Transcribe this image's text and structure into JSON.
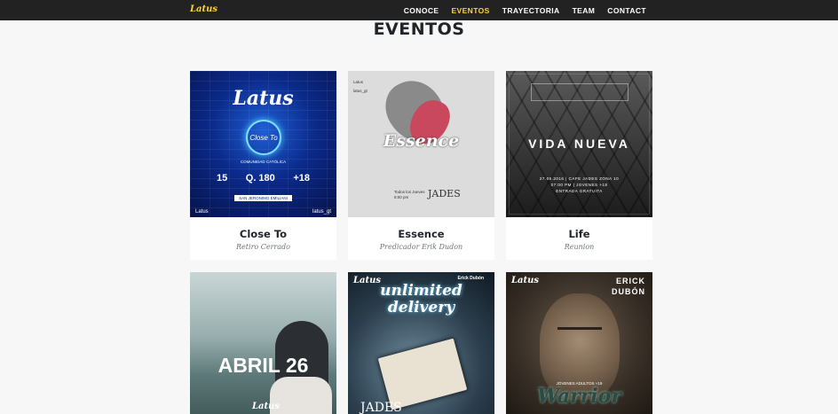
{
  "nav": {
    "brand": "Latus",
    "links": [
      "CONOCE",
      "EVENTOS",
      "TRAYECTORIA",
      "TEAM",
      "CONTACT"
    ],
    "active": "EVENTOS"
  },
  "section": {
    "title": "EVENTOS"
  },
  "colors": {
    "navbar": "#222222",
    "accent": "#fed136",
    "page": "#f7f7f7"
  },
  "events": [
    {
      "title": "Close To",
      "subtitle": "Retiro Cerrado",
      "poster": {
        "logo": "Latus",
        "badge": "Close To",
        "community": "COMUNIDAD CATÓLICA",
        "date_day": "15",
        "price": "Q. 180",
        "age": "+18",
        "place": "SAN JERONIMO EMILIANI",
        "footer_left": "Latus",
        "footer_right": "latus_gt"
      }
    },
    {
      "title": "Essence",
      "subtitle": "Predicador Erik Dudon",
      "poster": {
        "social_fb": "Latus",
        "social_ig": "latus_gt",
        "brand": "Essence",
        "when": "Todos los Jueves",
        "time": "8:00 pm",
        "venue": "JADES"
      }
    },
    {
      "title": "Life",
      "subtitle": "Reunion",
      "poster": {
        "headline": "VIDA NUEVA",
        "details": [
          "27.05.2016 | CAFE JADES ZONA 10",
          "07:00 PM | JOVENES +18",
          "ENTRADA GRATUITA"
        ]
      }
    },
    {
      "title": "",
      "subtitle": "",
      "poster": {
        "headline": "ABRIL 26",
        "logo": "Latus"
      }
    },
    {
      "title": "",
      "subtitle": "",
      "poster": {
        "author": "Erick Dubón",
        "logo": "Latus",
        "line1": "unlimited",
        "line2": "delivery",
        "venue": "JADES"
      }
    },
    {
      "title": "",
      "subtitle": "",
      "poster": {
        "name1": "ERICK",
        "name2": "DUBÓN",
        "logo": "Latus",
        "audience": "JÓVENES ADULTOS +19",
        "headline": "Warrior"
      }
    }
  ]
}
